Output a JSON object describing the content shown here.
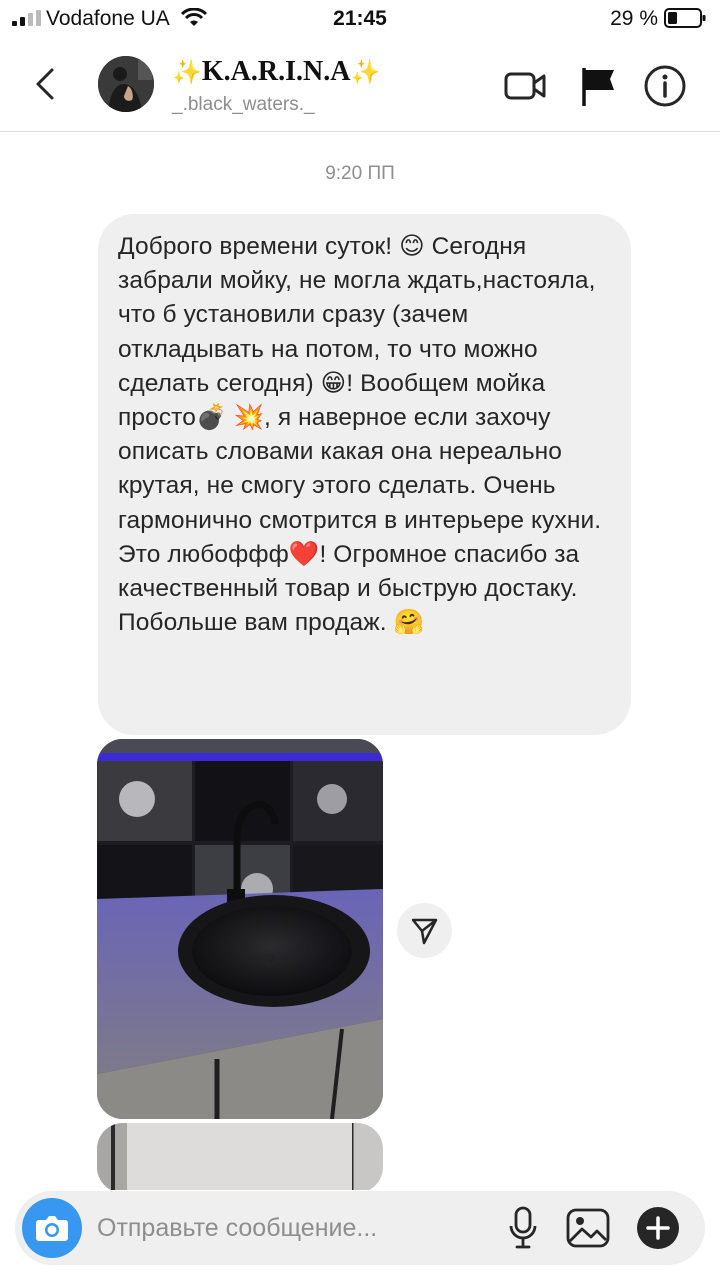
{
  "status_bar": {
    "carrier": "Vodafone UA",
    "time": "21:45",
    "battery_percent": "29 %"
  },
  "header": {
    "sparkle_left": "✨",
    "display_name": "K.A.R.I.N.A",
    "sparkle_right": "✨",
    "username": "_.black_waters._"
  },
  "chat": {
    "timestamp": "9:20 ПП",
    "message_text": "Доброго времени суток! 😊 Сегодня забрали мойку, не могла ждать,настояла, что б установили сразу (зачем откладывать на потом, то что можно сделать сегодня) 😁! Вообщем мойка просто💣 💥, я наверное если захочу описать словами какая она нереально крутая, не смогу этого сделать. Очень гармонично смотрится в интерьере кухни. Это любоффф❤️! Огромное спасибо за качественный товар и быструю достаку. Побольше вам продаж. 🤗"
  },
  "composer": {
    "placeholder": "Отправьте сообщение..."
  },
  "colors": {
    "accent": "#3897f0",
    "bubble": "#efefef",
    "secondary_text": "#8e8e8e",
    "sparkle": "#f4c21b"
  },
  "icons": {
    "back": "chevron-left-icon",
    "video": "video-camera-icon",
    "flag": "flag-icon",
    "info": "info-icon",
    "share": "paper-plane-icon",
    "camera": "camera-icon",
    "mic": "microphone-icon",
    "gallery": "gallery-icon",
    "plus": "plus-circle-icon"
  }
}
